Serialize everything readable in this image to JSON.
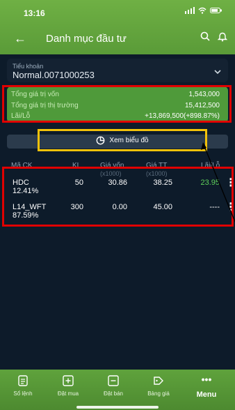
{
  "status_bar": {
    "time": "13:16"
  },
  "header": {
    "title": "Danh mục đầu tư"
  },
  "account": {
    "label": "Tiểu khoản",
    "value": "Normal.0071000253"
  },
  "summary": {
    "total_cost_label": "Tổng giá trị vốn",
    "total_cost_value": "1,543,000",
    "market_value_label": "Tổng giá trị thị trường",
    "market_value_value": "15,412,500",
    "pnl_label": "Lãi/Lỗ",
    "pnl_value": "+13,869,500(+898.87%)"
  },
  "chart_button": {
    "label": "Xem biểu đồ"
  },
  "table": {
    "headers": {
      "code": "Mã CK",
      "qty": "KL",
      "cost": "Giá vốn",
      "cost_unit": "(x1000)",
      "price": "Giá TT",
      "price_unit": "(x1000)",
      "pnl": "Lãi/Lỗ"
    },
    "rows": [
      {
        "code": "HDC",
        "pct": "12.41%",
        "qty": "50",
        "cost": "30.86",
        "price": "38.25",
        "pnl": "23.95"
      },
      {
        "code": "L14_WFT",
        "pct": "87.59%",
        "qty": "300",
        "cost": "0.00",
        "price": "45.00",
        "pnl": "----"
      }
    ]
  },
  "bottom_nav": {
    "items": [
      {
        "label": "Sổ lệnh",
        "icon": "order-book-icon"
      },
      {
        "label": "Đặt mua",
        "icon": "buy-icon"
      },
      {
        "label": "Đặt bán",
        "icon": "sell-icon"
      },
      {
        "label": "Bảng giá",
        "icon": "price-board-icon"
      },
      {
        "label": "Menu",
        "icon": "more-icon"
      }
    ]
  },
  "colors": {
    "brand_green": "#5a9b38",
    "background": "#0d1b2a",
    "highlight_red": "#e00000",
    "highlight_yellow": "#f2c20a",
    "positive": "#5fd05a"
  }
}
